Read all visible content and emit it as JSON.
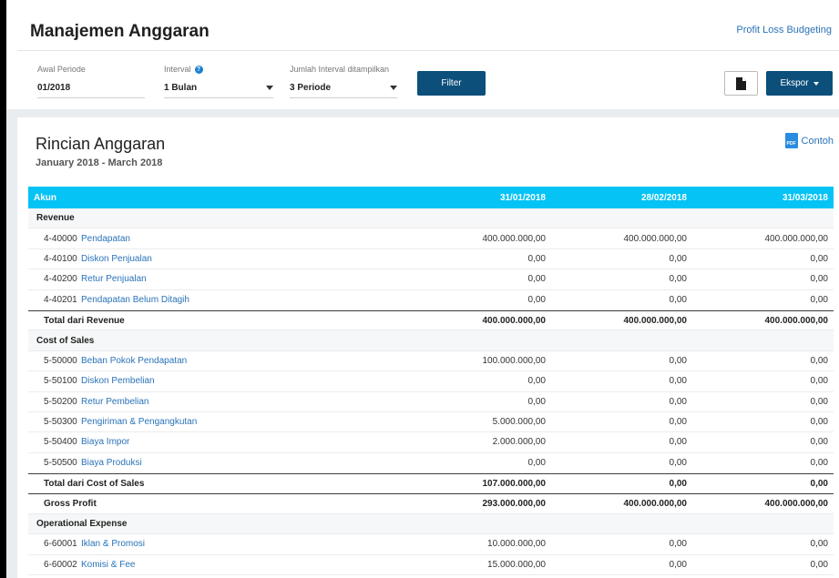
{
  "header": {
    "title": "Manajemen Anggaran",
    "top_link": "Profit Loss Budgeting"
  },
  "filters": {
    "awal_label": "Awal Periode",
    "awal_value": "01/2018",
    "interval_label": "Interval",
    "interval_value": "1 Bulan",
    "jumlah_label": "Jumlah Interval ditampilkan",
    "jumlah_value": "3 Periode",
    "filter_button": "Filter",
    "ekspor_button": "Ekspor"
  },
  "report": {
    "title": "Rincian Anggaran",
    "subtitle": "January 2018 - March 2018",
    "contoh": "Contoh"
  },
  "table": {
    "headers": [
      "Akun",
      "31/01/2018",
      "28/02/2018",
      "31/03/2018"
    ],
    "rows": [
      {
        "type": "section",
        "label": "Revenue"
      },
      {
        "type": "account",
        "code": "4-40000",
        "name": "Pendapatan",
        "values": [
          "400.000.000,00",
          "400.000.000,00",
          "400.000.000,00"
        ]
      },
      {
        "type": "account",
        "code": "4-40100",
        "name": "Diskon Penjualan",
        "values": [
          "0,00",
          "0,00",
          "0,00"
        ]
      },
      {
        "type": "account",
        "code": "4-40200",
        "name": "Retur Penjualan",
        "values": [
          "0,00",
          "0,00",
          "0,00"
        ]
      },
      {
        "type": "account",
        "code": "4-40201",
        "name": "Pendapatan Belum Ditagih",
        "values": [
          "0,00",
          "0,00",
          "0,00"
        ]
      },
      {
        "type": "total",
        "label": "Total dari Revenue",
        "values": [
          "400.000.000,00",
          "400.000.000,00",
          "400.000.000,00"
        ]
      },
      {
        "type": "section",
        "label": "Cost of Sales"
      },
      {
        "type": "account",
        "code": "5-50000",
        "name": "Beban Pokok Pendapatan",
        "values": [
          "100.000.000,00",
          "0,00",
          "0,00"
        ]
      },
      {
        "type": "account",
        "code": "5-50100",
        "name": "Diskon Pembelian",
        "values": [
          "0,00",
          "0,00",
          "0,00"
        ]
      },
      {
        "type": "account",
        "code": "5-50200",
        "name": "Retur Pembelian",
        "values": [
          "0,00",
          "0,00",
          "0,00"
        ]
      },
      {
        "type": "account",
        "code": "5-50300",
        "name": "Pengiriman & Pengangkutan",
        "values": [
          "5.000.000,00",
          "0,00",
          "0,00"
        ]
      },
      {
        "type": "account",
        "code": "5-50400",
        "name": "Biaya Impor",
        "values": [
          "2.000.000,00",
          "0,00",
          "0,00"
        ]
      },
      {
        "type": "account",
        "code": "5-50500",
        "name": "Biaya Produksi",
        "values": [
          "0,00",
          "0,00",
          "0,00"
        ]
      },
      {
        "type": "total",
        "label": "Total dari Cost of Sales",
        "values": [
          "107.000.000,00",
          "0,00",
          "0,00"
        ]
      },
      {
        "type": "total",
        "label": "Gross Profit",
        "values": [
          "293.000.000,00",
          "400.000.000,00",
          "400.000.000,00"
        ]
      },
      {
        "type": "section",
        "label": "Operational Expense"
      },
      {
        "type": "account",
        "code": "6-60001",
        "name": "Iklan & Promosi",
        "values": [
          "10.000.000,00",
          "0,00",
          "0,00"
        ]
      },
      {
        "type": "account",
        "code": "6-60002",
        "name": "Komisi & Fee",
        "values": [
          "15.000.000,00",
          "0,00",
          "0,00"
        ]
      }
    ]
  },
  "colors": {
    "table_header": "#05c3f5",
    "primary_button": "#0b4f7a",
    "link": "#2a73b8"
  }
}
